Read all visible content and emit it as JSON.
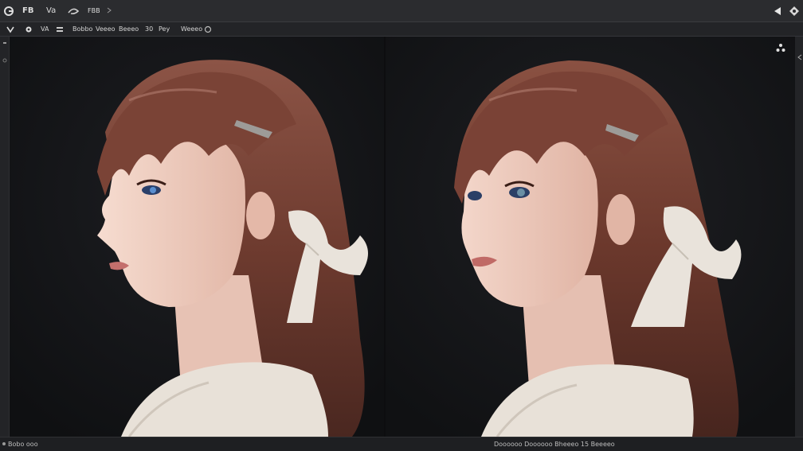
{
  "menu": {
    "label_1": "FB",
    "label_2": "Va",
    "label_3": "FBB"
  },
  "toolbar": {
    "labels": [
      "VA",
      "Bobbo",
      "Veeeo",
      "Beeeo",
      "30",
      "Pey",
      "Weeeo"
    ]
  },
  "statusbar": {
    "left": "Bobo ooo",
    "right": "Doooooo Doooooo Bheeeo 15 Beeeeo"
  },
  "colors": {
    "background": "#141518",
    "topbar": "#2b2c2f",
    "hair": "#6e3b2f",
    "skin": "#f0d0c4",
    "ribbon": "#e9e3db",
    "sweater": "#e8e1d8"
  },
  "icons": {
    "app": "app-logo-icon",
    "swirl": "swirl-icon",
    "back": "back-arrow-icon",
    "settings": "settings-icon",
    "share": "share-icon"
  }
}
